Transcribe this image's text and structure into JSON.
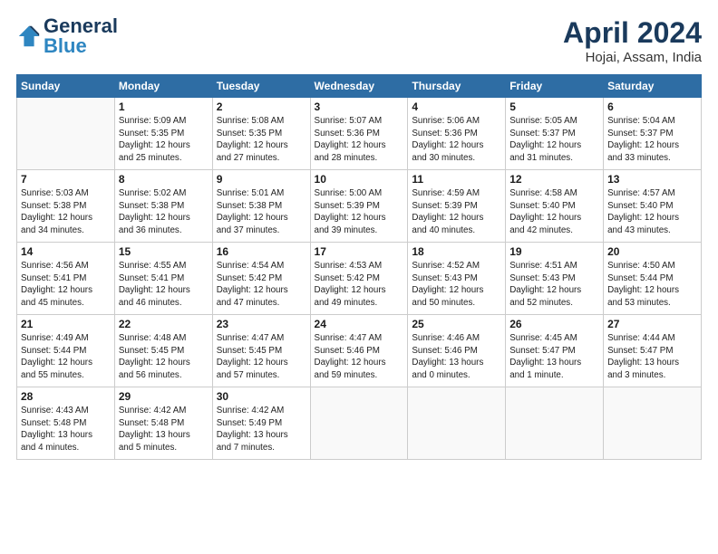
{
  "header": {
    "logo_general": "General",
    "logo_blue": "Blue",
    "month": "April 2024",
    "location": "Hojai, Assam, India"
  },
  "days_of_week": [
    "Sunday",
    "Monday",
    "Tuesday",
    "Wednesday",
    "Thursday",
    "Friday",
    "Saturday"
  ],
  "weeks": [
    [
      {
        "day": "",
        "info": ""
      },
      {
        "day": "1",
        "info": "Sunrise: 5:09 AM\nSunset: 5:35 PM\nDaylight: 12 hours\nand 25 minutes."
      },
      {
        "day": "2",
        "info": "Sunrise: 5:08 AM\nSunset: 5:35 PM\nDaylight: 12 hours\nand 27 minutes."
      },
      {
        "day": "3",
        "info": "Sunrise: 5:07 AM\nSunset: 5:36 PM\nDaylight: 12 hours\nand 28 minutes."
      },
      {
        "day": "4",
        "info": "Sunrise: 5:06 AM\nSunset: 5:36 PM\nDaylight: 12 hours\nand 30 minutes."
      },
      {
        "day": "5",
        "info": "Sunrise: 5:05 AM\nSunset: 5:37 PM\nDaylight: 12 hours\nand 31 minutes."
      },
      {
        "day": "6",
        "info": "Sunrise: 5:04 AM\nSunset: 5:37 PM\nDaylight: 12 hours\nand 33 minutes."
      }
    ],
    [
      {
        "day": "7",
        "info": "Sunrise: 5:03 AM\nSunset: 5:38 PM\nDaylight: 12 hours\nand 34 minutes."
      },
      {
        "day": "8",
        "info": "Sunrise: 5:02 AM\nSunset: 5:38 PM\nDaylight: 12 hours\nand 36 minutes."
      },
      {
        "day": "9",
        "info": "Sunrise: 5:01 AM\nSunset: 5:38 PM\nDaylight: 12 hours\nand 37 minutes."
      },
      {
        "day": "10",
        "info": "Sunrise: 5:00 AM\nSunset: 5:39 PM\nDaylight: 12 hours\nand 39 minutes."
      },
      {
        "day": "11",
        "info": "Sunrise: 4:59 AM\nSunset: 5:39 PM\nDaylight: 12 hours\nand 40 minutes."
      },
      {
        "day": "12",
        "info": "Sunrise: 4:58 AM\nSunset: 5:40 PM\nDaylight: 12 hours\nand 42 minutes."
      },
      {
        "day": "13",
        "info": "Sunrise: 4:57 AM\nSunset: 5:40 PM\nDaylight: 12 hours\nand 43 minutes."
      }
    ],
    [
      {
        "day": "14",
        "info": "Sunrise: 4:56 AM\nSunset: 5:41 PM\nDaylight: 12 hours\nand 45 minutes."
      },
      {
        "day": "15",
        "info": "Sunrise: 4:55 AM\nSunset: 5:41 PM\nDaylight: 12 hours\nand 46 minutes."
      },
      {
        "day": "16",
        "info": "Sunrise: 4:54 AM\nSunset: 5:42 PM\nDaylight: 12 hours\nand 47 minutes."
      },
      {
        "day": "17",
        "info": "Sunrise: 4:53 AM\nSunset: 5:42 PM\nDaylight: 12 hours\nand 49 minutes."
      },
      {
        "day": "18",
        "info": "Sunrise: 4:52 AM\nSunset: 5:43 PM\nDaylight: 12 hours\nand 50 minutes."
      },
      {
        "day": "19",
        "info": "Sunrise: 4:51 AM\nSunset: 5:43 PM\nDaylight: 12 hours\nand 52 minutes."
      },
      {
        "day": "20",
        "info": "Sunrise: 4:50 AM\nSunset: 5:44 PM\nDaylight: 12 hours\nand 53 minutes."
      }
    ],
    [
      {
        "day": "21",
        "info": "Sunrise: 4:49 AM\nSunset: 5:44 PM\nDaylight: 12 hours\nand 55 minutes."
      },
      {
        "day": "22",
        "info": "Sunrise: 4:48 AM\nSunset: 5:45 PM\nDaylight: 12 hours\nand 56 minutes."
      },
      {
        "day": "23",
        "info": "Sunrise: 4:47 AM\nSunset: 5:45 PM\nDaylight: 12 hours\nand 57 minutes."
      },
      {
        "day": "24",
        "info": "Sunrise: 4:47 AM\nSunset: 5:46 PM\nDaylight: 12 hours\nand 59 minutes."
      },
      {
        "day": "25",
        "info": "Sunrise: 4:46 AM\nSunset: 5:46 PM\nDaylight: 13 hours\nand 0 minutes."
      },
      {
        "day": "26",
        "info": "Sunrise: 4:45 AM\nSunset: 5:47 PM\nDaylight: 13 hours\nand 1 minute."
      },
      {
        "day": "27",
        "info": "Sunrise: 4:44 AM\nSunset: 5:47 PM\nDaylight: 13 hours\nand 3 minutes."
      }
    ],
    [
      {
        "day": "28",
        "info": "Sunrise: 4:43 AM\nSunset: 5:48 PM\nDaylight: 13 hours\nand 4 minutes."
      },
      {
        "day": "29",
        "info": "Sunrise: 4:42 AM\nSunset: 5:48 PM\nDaylight: 13 hours\nand 5 minutes."
      },
      {
        "day": "30",
        "info": "Sunrise: 4:42 AM\nSunset: 5:49 PM\nDaylight: 13 hours\nand 7 minutes."
      },
      {
        "day": "",
        "info": ""
      },
      {
        "day": "",
        "info": ""
      },
      {
        "day": "",
        "info": ""
      },
      {
        "day": "",
        "info": ""
      }
    ]
  ]
}
